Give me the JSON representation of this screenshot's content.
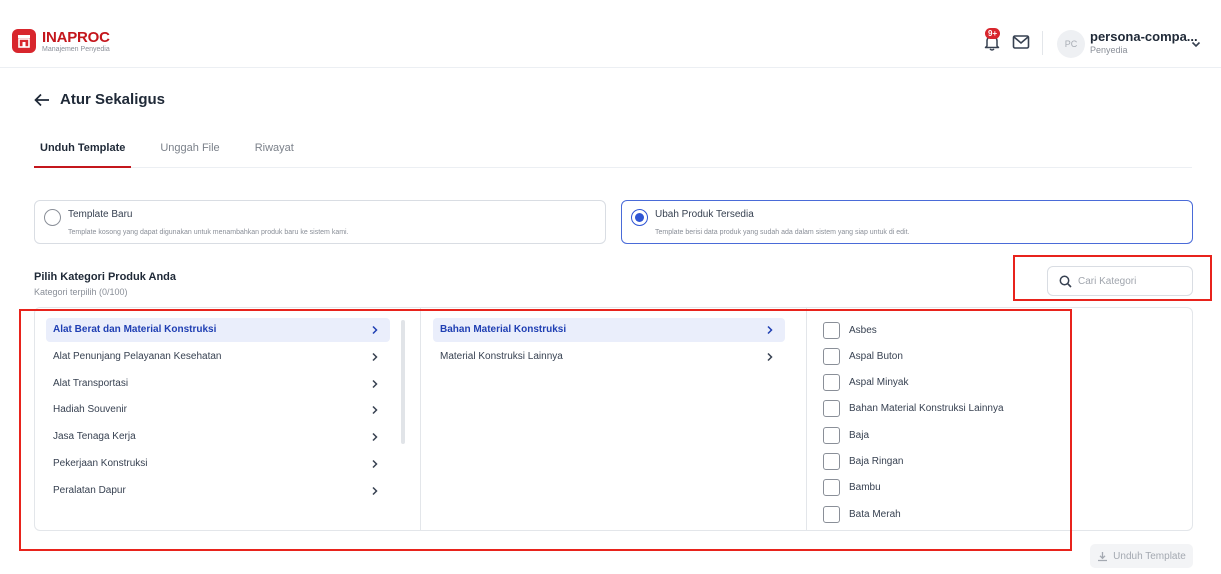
{
  "header": {
    "brand_name": "INAPROC",
    "brand_sub": "Manajemen Penyedia",
    "notification_badge": "9+",
    "user_initials": "PC",
    "user_name": "persona-compa...",
    "user_role": "Penyedia"
  },
  "page": {
    "title": "Atur Sekaligus"
  },
  "tabs": [
    {
      "label": "Unduh Template",
      "active": true
    },
    {
      "label": "Unggah File",
      "active": false
    },
    {
      "label": "Riwayat",
      "active": false
    }
  ],
  "template_options": [
    {
      "title": "Template Baru",
      "description": "Template kosong yang dapat digunakan untuk menambahkan produk baru ke sistem kami.",
      "selected": false
    },
    {
      "title": "Ubah Produk Tersedia",
      "description": "Template berisi data produk yang sudah ada dalam sistem yang siap untuk di edit.",
      "selected": true
    }
  ],
  "category": {
    "title": "Pilih Kategori Produk Anda",
    "count_label": "Kategori terpilih (0/100)",
    "search_placeholder": "Cari Kategori"
  },
  "level1": [
    {
      "label": "Alat Berat dan Material Konstruksi",
      "selected": true
    },
    {
      "label": "Alat Penunjang Pelayanan Kesehatan",
      "selected": false
    },
    {
      "label": "Alat Transportasi",
      "selected": false
    },
    {
      "label": "Hadiah Souvenir",
      "selected": false
    },
    {
      "label": "Jasa Tenaga Kerja",
      "selected": false
    },
    {
      "label": "Pekerjaan Konstruksi",
      "selected": false
    },
    {
      "label": "Peralatan Dapur",
      "selected": false
    }
  ],
  "level2": [
    {
      "label": "Bahan Material Konstruksi",
      "selected": true
    },
    {
      "label": "Material Konstruksi Lainnya",
      "selected": false
    }
  ],
  "level3": [
    {
      "label": "Asbes",
      "checked": false
    },
    {
      "label": "Aspal Buton",
      "checked": false
    },
    {
      "label": "Aspal Minyak",
      "checked": false
    },
    {
      "label": "Bahan Material Konstruksi Lainnya",
      "checked": false
    },
    {
      "label": "Baja",
      "checked": false
    },
    {
      "label": "Baja Ringan",
      "checked": false
    },
    {
      "label": "Bambu",
      "checked": false
    },
    {
      "label": "Bata Merah",
      "checked": false
    }
  ],
  "actions": {
    "download_label": "Unduh Template"
  },
  "colors": {
    "brand": "#d8262d",
    "accent": "#2f55d4",
    "annotation": "#e8231c"
  }
}
